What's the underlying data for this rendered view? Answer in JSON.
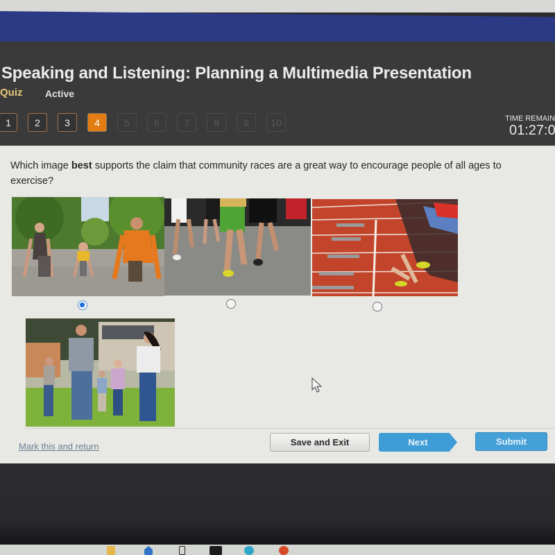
{
  "header": {
    "title": "Speaking and Listening: Planning a Multimedia Presentation",
    "type_label": "Quiz",
    "status_label": "Active"
  },
  "question_nav": {
    "current": 4,
    "answered_through": 3,
    "items": [
      "1",
      "2",
      "3",
      "4",
      "5",
      "6",
      "7",
      "8",
      "9",
      "10"
    ]
  },
  "timer": {
    "label": "TIME REMAIN",
    "value": "01:27:0"
  },
  "question": {
    "prefix": "Which image ",
    "emphasis": "best",
    "suffix": " supports the claim that community races are a great way to encourage people of all ages to exercise?"
  },
  "choices": [
    {
      "id": "a",
      "description": "Woman, boy and man in starting position on a tree-lined road",
      "selected": true
    },
    {
      "id": "b",
      "description": "Crowd of runners' legs on asphalt road race",
      "selected": false
    },
    {
      "id": "c",
      "description": "Sprinters leaving starting blocks on red running track",
      "selected": false
    },
    {
      "id": "d",
      "description": "Family of parents and three children running on grass",
      "selected": null
    }
  ],
  "footer": {
    "mark_link": "Mark this and return",
    "save_label": "Save and Exit",
    "next_label": "Next",
    "submit_label": "Submit"
  },
  "colors": {
    "brand_blue_bar": "#2c3985",
    "current_question": "#e37d13",
    "quiz_label": "#e6c779",
    "primary_button": "#3e9cd6",
    "radio_selected": "#1a6ee0"
  }
}
